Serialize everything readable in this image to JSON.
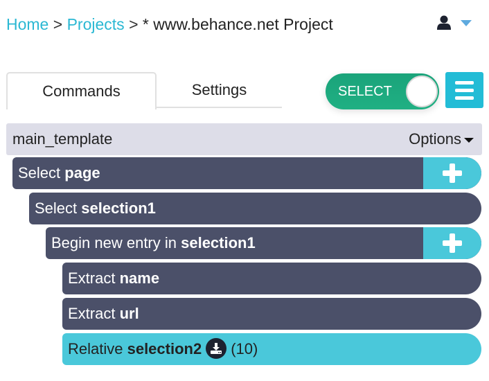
{
  "breadcrumb": {
    "items": [
      {
        "label": "Home",
        "link": true
      },
      {
        "label": "Projects",
        "link": true
      },
      {
        "label": "* www.behance.net Project",
        "link": false
      }
    ],
    "separator": ">"
  },
  "user_menu": {
    "icon": "user-icon",
    "caret": "caret-down-icon"
  },
  "tabs": [
    {
      "label": "Commands",
      "active": true
    },
    {
      "label": "Settings",
      "active": false
    }
  ],
  "mode_toggle": {
    "label": "SELECT",
    "on": true
  },
  "menu_button": {
    "icon": "hamburger-icon"
  },
  "template": {
    "name": "main_template",
    "options_label": "Options"
  },
  "commands": [
    {
      "verb": "Select",
      "target": "page",
      "has_add": true
    },
    {
      "verb": "Select",
      "target": "selection1",
      "has_add": false
    },
    {
      "verb": "Begin new entry in",
      "target": "selection1",
      "has_add": true
    },
    {
      "verb": "Extract",
      "target": "name",
      "has_add": false
    },
    {
      "verb": "Extract",
      "target": "url",
      "has_add": false
    },
    {
      "verb": "Relative",
      "target": "selection2",
      "count": "(10)",
      "has_add": false,
      "highlighted": true
    }
  ],
  "colors": {
    "accent": "#2bb8d3",
    "toggle_green": "#1aa37a",
    "command_bg": "#4b5069",
    "highlight_bg": "#4ac8da",
    "template_bg": "#dddde8"
  }
}
